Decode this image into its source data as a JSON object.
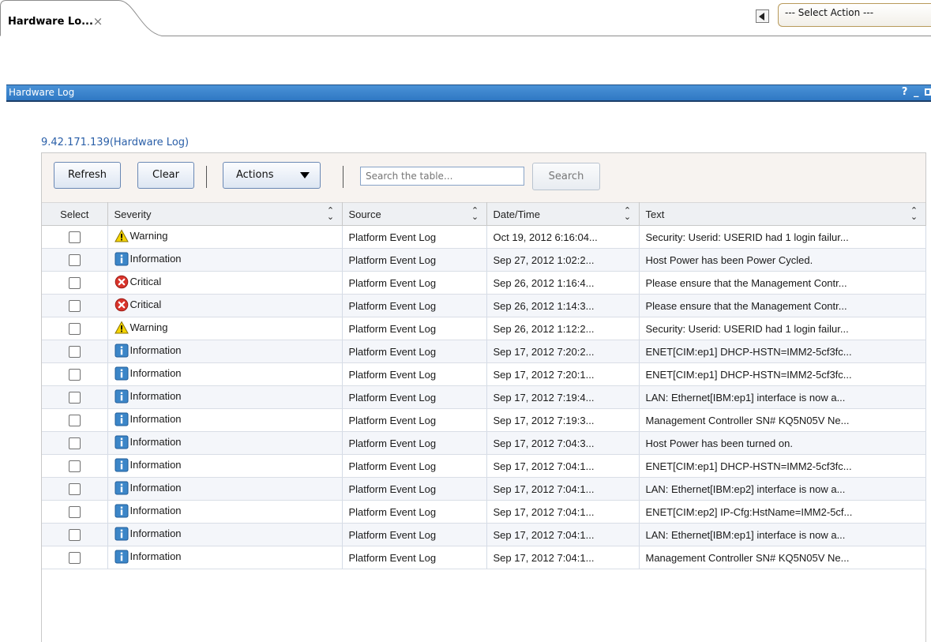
{
  "tab": {
    "label": "Hardware Lo...",
    "close_glyph": "×"
  },
  "action_select": {
    "value": "--- Select Action ---"
  },
  "portlet": {
    "title": "Hardware Log",
    "help": "?",
    "minimize": "_"
  },
  "breadcrumb": "9.42.171.139(Hardware Log)",
  "toolbar": {
    "refresh": "Refresh",
    "clear": "Clear",
    "actions": "Actions",
    "search_placeholder": "Search the table...",
    "search": "Search"
  },
  "columns": {
    "select": "Select",
    "severity": "Severity",
    "source": "Source",
    "datetime": "Date/Time",
    "text": "Text"
  },
  "severity_icons": {
    "Warning": "warning-icon",
    "Information": "information-icon",
    "Critical": "critical-icon"
  },
  "colors": {
    "portlet_bar": "#2f78c4",
    "link": "#2a5fa8",
    "warning": "#f5d400",
    "info": "#3c86c8",
    "critical": "#d9342b"
  },
  "rows": [
    {
      "severity": "Warning",
      "source": "Platform Event Log",
      "datetime": "Oct 19, 2012 6:16:04...",
      "text": "Security: Userid: USERID had 1 login failur..."
    },
    {
      "severity": "Information",
      "source": "Platform Event Log",
      "datetime": "Sep 27, 2012 1:02:2...",
      "text": "Host Power has been Power Cycled."
    },
    {
      "severity": "Critical",
      "source": "Platform Event Log",
      "datetime": "Sep 26, 2012 1:16:4...",
      "text": "Please ensure that the Management Contr..."
    },
    {
      "severity": "Critical",
      "source": "Platform Event Log",
      "datetime": "Sep 26, 2012 1:14:3...",
      "text": "Please ensure that the Management Contr..."
    },
    {
      "severity": "Warning",
      "source": "Platform Event Log",
      "datetime": "Sep 26, 2012 1:12:2...",
      "text": "Security: Userid: USERID had 1 login failur..."
    },
    {
      "severity": "Information",
      "source": "Platform Event Log",
      "datetime": "Sep 17, 2012 7:20:2...",
      "text": "ENET[CIM:ep1] DHCP-HSTN=IMM2-5cf3fc..."
    },
    {
      "severity": "Information",
      "source": "Platform Event Log",
      "datetime": "Sep 17, 2012 7:20:1...",
      "text": "ENET[CIM:ep1] DHCP-HSTN=IMM2-5cf3fc..."
    },
    {
      "severity": "Information",
      "source": "Platform Event Log",
      "datetime": "Sep 17, 2012 7:19:4...",
      "text": "LAN: Ethernet[IBM:ep1] interface is now a..."
    },
    {
      "severity": "Information",
      "source": "Platform Event Log",
      "datetime": "Sep 17, 2012 7:19:3...",
      "text": "Management Controller SN# KQ5N05V Ne..."
    },
    {
      "severity": "Information",
      "source": "Platform Event Log",
      "datetime": "Sep 17, 2012 7:04:3...",
      "text": "Host Power has been turned on."
    },
    {
      "severity": "Information",
      "source": "Platform Event Log",
      "datetime": "Sep 17, 2012 7:04:1...",
      "text": "ENET[CIM:ep1] DHCP-HSTN=IMM2-5cf3fc..."
    },
    {
      "severity": "Information",
      "source": "Platform Event Log",
      "datetime": "Sep 17, 2012 7:04:1...",
      "text": "LAN: Ethernet[IBM:ep2] interface is now a..."
    },
    {
      "severity": "Information",
      "source": "Platform Event Log",
      "datetime": "Sep 17, 2012 7:04:1...",
      "text": "ENET[CIM:ep2] IP-Cfg:HstName=IMM2-5cf..."
    },
    {
      "severity": "Information",
      "source": "Platform Event Log",
      "datetime": "Sep 17, 2012 7:04:1...",
      "text": "LAN: Ethernet[IBM:ep1] interface is now a..."
    },
    {
      "severity": "Information",
      "source": "Platform Event Log",
      "datetime": "Sep 17, 2012 7:04:1...",
      "text": "Management Controller SN# KQ5N05V Ne..."
    }
  ]
}
